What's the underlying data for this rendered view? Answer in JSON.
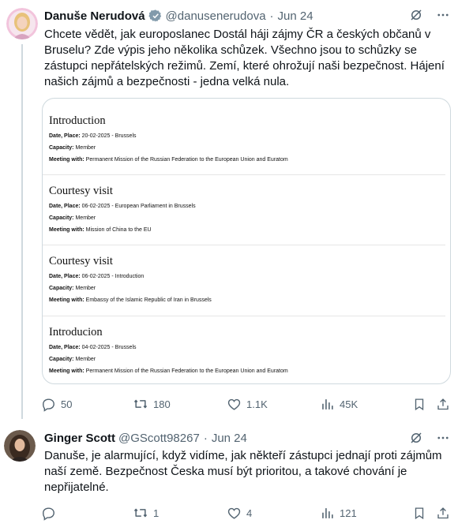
{
  "tweets": [
    {
      "author_name": "Danuše Nerudová",
      "handle": "@danusenerudova",
      "separator": "·",
      "date": "Jun 24",
      "text": "Chcete vědět, jak europoslanec Dostál háji zájmy ČR a českých občanů v Bruselu? Zde výpis jeho několika schůzek. Všechno jsou to schůzky se zástupci nepřátelských režimů. Zemí, které ohrožují naši bezpečnost. Hájení našich zájmů a bezpečnosti - jedna velká nula.",
      "card": {
        "entries": [
          {
            "title": "Introduction",
            "rows": [
              {
                "label": "Date, Place:",
                "value": "20-02-2025 - Brussels"
              },
              {
                "label": "Capacity:",
                "value": "Member"
              },
              {
                "label": "Meeting with:",
                "value": "Permanent Mission of the Russian Federation to the European Union and Euratom"
              }
            ]
          },
          {
            "title": "Courtesy visit",
            "rows": [
              {
                "label": "Date, Place:",
                "value": "06-02-2025 - European Parliament in Brussels"
              },
              {
                "label": "Capacity:",
                "value": "Member"
              },
              {
                "label": "Meeting with:",
                "value": "Mission of China to the EU"
              }
            ]
          },
          {
            "title": "Courtesy visit",
            "rows": [
              {
                "label": "Date, Place:",
                "value": "06-02-2025 - Introduction"
              },
              {
                "label": "Capacity:",
                "value": "Member"
              },
              {
                "label": "Meeting with:",
                "value": "Embassy of the Islamic Republic of Iran in Brussels"
              }
            ]
          },
          {
            "title": "Introducion",
            "rows": [
              {
                "label": "Date, Place:",
                "value": "04-02-2025 - Brussels"
              },
              {
                "label": "Capacity:",
                "value": "Member"
              },
              {
                "label": "Meeting with:",
                "value": "Permanent Mission of the Russian Federation to the European Union and Euratom"
              }
            ]
          }
        ]
      },
      "stats": {
        "replies": "50",
        "reposts": "180",
        "likes": "1.1K",
        "views": "45K"
      }
    },
    {
      "author_name": "Ginger Scott",
      "handle": "@GScott98267",
      "separator": "·",
      "date": "Jun 24",
      "text": "Danuše, je alarmující, když vidíme, jak někteří zástupci jednají proti zájmům naší země. Bezpečnost Česka musí být prioritou, a takové chování je nepřijatelné.",
      "stats": {
        "replies": "",
        "reposts": "1",
        "likes": "4",
        "views": "121"
      }
    }
  ],
  "colors": {
    "text": "#0f1419",
    "muted": "#536471",
    "border": "#cfd9de"
  },
  "icons": [
    "grok-icon",
    "more-icon",
    "reply-icon",
    "repost-icon",
    "like-icon",
    "views-icon",
    "bookmark-icon",
    "share-icon"
  ]
}
